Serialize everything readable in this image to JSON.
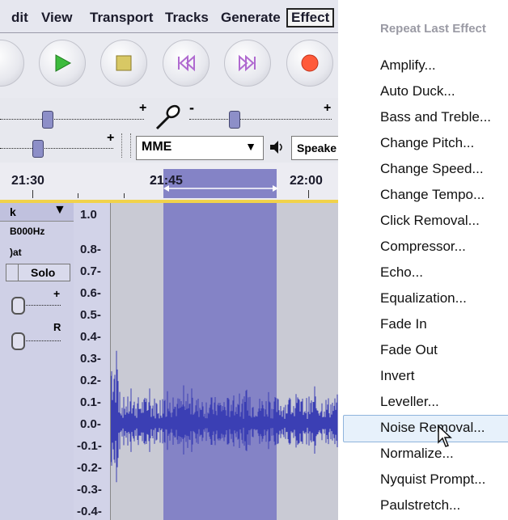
{
  "menubar": {
    "items": [
      "dit",
      "View",
      "Transport",
      "Tracks",
      "Generate",
      "Effect"
    ]
  },
  "transport": {
    "buttons": [
      "skip-back",
      "play",
      "stop",
      "skip-start",
      "skip-end",
      "record"
    ]
  },
  "meters": {
    "plus1": "+",
    "minus": "-",
    "plus2": "+",
    "plus3": "+",
    "device": "MME",
    "output": "Speake"
  },
  "timeline": {
    "labels": [
      "21:30",
      "21:45",
      "22:00"
    ]
  },
  "track": {
    "menu_arrow": "k",
    "rate": "B000Hz",
    "format": ")at",
    "solo": "Solo",
    "gain_plus": "+",
    "pan_r": "R"
  },
  "ruler": {
    "labels": [
      "1.0",
      "0.8-",
      "0.7-",
      "0.6-",
      "0.5-",
      "0.4-",
      "0.3-",
      "0.2-",
      "0.1-",
      "0.0-",
      "-0.1-",
      "-0.2-",
      "-0.3-",
      "-0.4-"
    ]
  },
  "effect_menu": {
    "header": "Repeat Last Effect",
    "items": [
      "Amplify...",
      "Auto Duck...",
      "Bass and Treble...",
      "Change Pitch...",
      "Change Speed...",
      "Change Tempo...",
      "Click Removal...",
      "Compressor...",
      "Echo...",
      "Equalization...",
      "Fade In",
      "Fade Out",
      "Invert",
      "Leveller...",
      "Noise Removal...",
      "Normalize...",
      "Nyquist Prompt...",
      "Paulstretch..."
    ],
    "highlighted": "Noise Removal..."
  },
  "colors": {
    "selection": "#8483c6",
    "waveform": "#3b3fb4",
    "play": "#3dbb3d",
    "record": "#ff5a3a",
    "stop": "#d8c864",
    "skip": "#b06ad0"
  }
}
